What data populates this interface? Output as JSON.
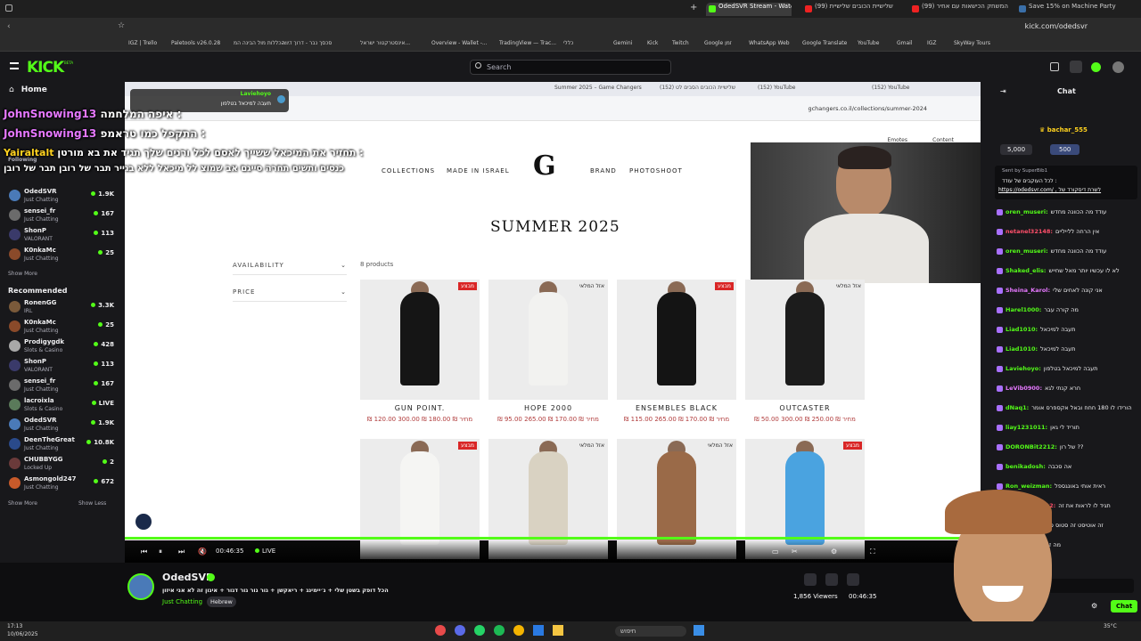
{
  "browser": {
    "tabs": [
      {
        "label": "OdedSVR Stream - Watch Live...",
        "active": true
      },
      {
        "label": "שלישיית הכובים שלישיית (99)"
      },
      {
        "label": "המשחק הכישאות עם אחיר (99)"
      },
      {
        "label": "Save 15% on Machine Party on..."
      }
    ],
    "url": "kick.com/odedsvr",
    "bookmarks": [
      "IGZ | Trello",
      "Paletools v26.0.28",
      "הכללות מול הבינה המ...",
      "סכסך נבר - דרוך דיויה",
      "אינסטרקטור ישראל...",
      "Overview - Wallet -...",
      "TradingView — Trac...",
      "כללי",
      "Gemini",
      "Kick",
      "Twitch",
      "Google זמן",
      "WhatsApp Web",
      "Google Translate",
      "YouTube",
      "Gmail",
      "IGZ",
      "SkyWay Tours"
    ]
  },
  "kick": {
    "logo": "KICK",
    "beta": "BETA",
    "home": "Home",
    "search_placeholder": "Search",
    "chat_title": "Chat",
    "following_title": "Following",
    "recommended_title": "Recommended",
    "show_more": "Show More",
    "show_less": "Show Less",
    "following": [
      {
        "name": "OdedSVR",
        "category": "Just Chatting",
        "viewers": "1.9K",
        "color": "#4a7ab8"
      },
      {
        "name": "sensei_fr",
        "category": "Just Chatting",
        "viewers": "167",
        "color": "#6b6b6b"
      },
      {
        "name": "ShonP",
        "category": "VALORANT",
        "viewers": "113",
        "color": "#3a3a6a"
      },
      {
        "name": "K0nkaMc",
        "category": "Just Chatting",
        "viewers": "25",
        "color": "#8a4a2a"
      }
    ],
    "recommended": [
      {
        "name": "RonenGG",
        "category": "IRL",
        "viewers": "3.3K",
        "color": "#7a5a3a"
      },
      {
        "name": "K0nkaMc",
        "category": "Just Chatting",
        "viewers": "25",
        "color": "#8a4a2a"
      },
      {
        "name": "Prodigygdk",
        "category": "Slots & Casino",
        "viewers": "428",
        "color": "#a8a8a8"
      },
      {
        "name": "ShonP",
        "category": "VALORANT",
        "viewers": "113",
        "color": "#3a3a6a"
      },
      {
        "name": "sensei_fr",
        "category": "Just Chatting",
        "viewers": "167",
        "color": "#6b6b6b"
      },
      {
        "name": "lacroixla",
        "category": "Slots & Casino",
        "viewers": "LIVE",
        "color": "#5a7a5a"
      },
      {
        "name": "OdedSVR",
        "category": "Just Chatting",
        "viewers": "1.9K",
        "color": "#4a7ab8"
      },
      {
        "name": "DeenTheGreat",
        "category": "Just Chatting",
        "viewers": "10.8K",
        "color": "#2a4a8a"
      },
      {
        "name": "CHUBBYGG",
        "category": "Locked Up",
        "viewers": "2",
        "color": "#6a3a3a"
      },
      {
        "name": "Asmongold247",
        "category": "Just Chatting",
        "viewers": "672",
        "color": "#c85a2a"
      }
    ]
  },
  "overlay": {
    "alert_user": "Laviehoyo",
    "alert_text": "תעבה למיכאל בטלפון",
    "chat_lines": [
      {
        "user": "JohnSnowing13",
        "text": "איפה המלחמה : "
      },
      {
        "user": "JohnSnowing13",
        "text": "התקפל כמו טראמפ : "
      },
      {
        "user": "Yairaltalt",
        "text": "תחזיר את המיכאל ששייך לאסם לכל ורנים שלך תגיד את בא מורטן : "
      },
      {
        "user": "",
        "text": "כנסים ותשים תחרה סייגם אב שמוצ לל מיכאל ללא בגייר תבר של רובן תבר של רובן"
      }
    ]
  },
  "shop": {
    "url": "gchangers.co.il/collections/summer-2024",
    "inner_tabs": [
      "Summer 2025 – Game Changers",
      "שלישיית הכובים הסבים לט (152)",
      "(152) YouTube",
      "(152) YouTube"
    ],
    "emotes_label": "Emotes",
    "content_label": "Content",
    "nav": [
      "COLLECTIONS",
      "MADE IN ISRAEL",
      "BRAND",
      "PHOTOSHOOT"
    ],
    "logo": "G",
    "title": "SUMMER 2025",
    "filters": [
      "AVAILABILITY",
      "PRICE"
    ],
    "count": "8 products",
    "products": [
      {
        "name": "GUN POINT.",
        "price": "₪ 120.00 מחיר",
        "old": "₪ 180.00 ₪ 300.00",
        "shirt": "#151515",
        "badge": "מבצע"
      },
      {
        "name": "HOPE 2000",
        "price": "₪ 95.00 מחיר",
        "old": "₪ 170.00 ₪ 265.00",
        "shirt": "#f2f2f0",
        "badge": "אזל המלאי"
      },
      {
        "name": "ENSEMBLES BLACK",
        "price": "₪ 115.00 מחיר",
        "old": "₪ 170.00 ₪ 265.00",
        "shirt": "#141414",
        "badge": "מבצע"
      },
      {
        "name": "OUTCASTER",
        "price": "₪ 50.00 מחיר",
        "old": "₪ 250.00 ₪ 300.00",
        "shirt": "#1c1c1c",
        "badge": "אזל המלאי"
      },
      {
        "name": "",
        "price": "",
        "old": "",
        "shirt": "#f5f5f3",
        "badge": "מבצע"
      },
      {
        "name": "",
        "price": "",
        "old": "",
        "shirt": "#d9d2c2",
        "badge": "אזל המלאי"
      },
      {
        "name": "",
        "price": "",
        "old": "",
        "shirt": "#9a6a48",
        "badge": "אזל המלאי"
      },
      {
        "name": "",
        "price": "",
        "old": "",
        "shirt": "#4aa3e0",
        "badge": "מבצע"
      }
    ]
  },
  "player": {
    "time": "00:46:35",
    "live": "LIVE"
  },
  "stream": {
    "name": "OdedSVR",
    "title": "הכל דופק בשטן שלי + ג׳יימינג + ריאקשן + גור גור גור דגור + איגון זה לא אני איזון",
    "category": "Just Chatting",
    "tag": "Hebrew",
    "viewers": "1,856 Viewers",
    "uptime": "00:46:35"
  },
  "chat": {
    "top_user": "bachar_555",
    "pill1": "5,000",
    "pill2": "500",
    "pinned_by": "Sent by SuperBib1",
    "pinned_text": "לכל העוקבים של עודד :",
    "pinned_link": "https://odedsvr.com/ , לשרת דיסקורד של",
    "messages": [
      {
        "user": "oren_museri",
        "text": "עודד מה הכוונה מחדש",
        "color": "#53fc18"
      },
      {
        "user": "netanel32148",
        "text": "אין הרחה ללייליים",
        "color": "#ff4f6a"
      },
      {
        "user": "oren_museri",
        "text": "עודד מה הכוונה מחדש",
        "color": "#53fc18"
      },
      {
        "user": "Shaked_elis",
        "text": "לא לו עכשיו יותר מאל שחייש",
        "color": "#53fc18"
      },
      {
        "user": "Sheina_Karol",
        "text": "אני קונה לאחים שלי",
        "color": "#e678ff"
      },
      {
        "user": "Harel1000",
        "text": "מה קורה עבר",
        "color": "#53fc18"
      },
      {
        "user": "Liad1010",
        "text": "תעבה למיכאל",
        "color": "#53fc18"
      },
      {
        "user": "Liad1010",
        "text": "תעבה למיכאל",
        "color": "#53fc18"
      },
      {
        "user": "Laviehoyo",
        "text": "תעבה למיכאל בטלפון",
        "color": "#53fc18"
      },
      {
        "user": "LeVib0900",
        "text": "חרא קנתי לגא",
        "color": "#e678ff"
      },
      {
        "user": "dNaq1",
        "text": "הורידו לו 180 חחח ובאל אקספרס אומר",
        "color": "#53fc18"
      },
      {
        "user": "liay1231011",
        "text": "תוריד לי גאן",
        "color": "#53fc18"
      },
      {
        "user": "DORONBit2212",
        "text": "של רון ??",
        "color": "#53fc18"
      },
      {
        "user": "benikadosh",
        "text": "אה סכבה",
        "color": "#53fc18"
      },
      {
        "user": "Ron_weizman",
        "text": "ראית אותי באונגספל",
        "color": "#53fc18"
      },
      {
        "user": "Watermelon92",
        "text": "תגיד לו לראות את זה",
        "color": "#ff4f6a"
      },
      {
        "user": "Jen_51",
        "text": "זה אוטיסט זה סטוס סטוס לא",
        "color": "#53fc18"
      },
      {
        "user": "mooma_17",
        "text": "מה זה",
        "color": "#e678ff"
      }
    ],
    "send_placeholder": "Send message...",
    "chat_button": "Chat"
  },
  "taskbar": {
    "search": "חיפוש",
    "time": "17:13",
    "date": "10/06/2025",
    "weather": "35°C"
  }
}
